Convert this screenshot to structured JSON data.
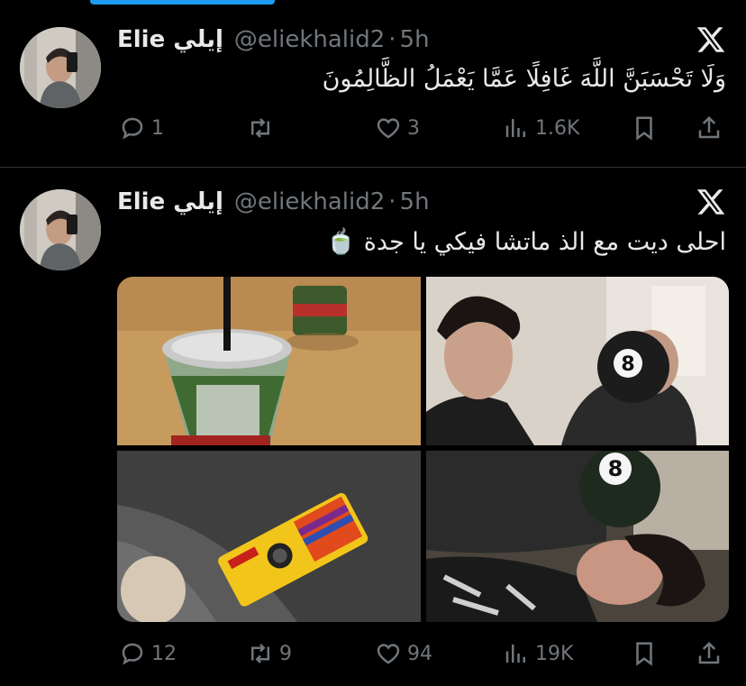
{
  "tweets": [
    {
      "name": "Elie إيلي",
      "handle": "@eliekhalid2",
      "separator": "·",
      "time": "5h",
      "text": "وَلَا تَحْسَبَنَّ اللَّهَ غَافِلًا عَمَّا يَعْمَلُ الظَّالِمُونَ",
      "stats": {
        "replies": "1",
        "reposts": "",
        "likes": "3",
        "views": "1.6K"
      }
    },
    {
      "name": "Elie إيلي",
      "handle": "@eliekhalid2",
      "separator": "·",
      "time": "5h",
      "text": "احلى ديت مع الذ ماتشا فيكي يا جدة 🍵",
      "stats": {
        "replies": "12",
        "reposts": "9",
        "likes": "94",
        "views": "19K"
      }
    }
  ],
  "colors": {
    "background": "#000000",
    "text": "#e7e9ea",
    "muted": "#71767b",
    "accent": "#1d9bf0",
    "divider": "#2f3336"
  },
  "icons": [
    "x-logo-icon",
    "reply-icon",
    "repost-icon",
    "like-icon",
    "views-icon",
    "bookmark-icon",
    "share-icon"
  ]
}
